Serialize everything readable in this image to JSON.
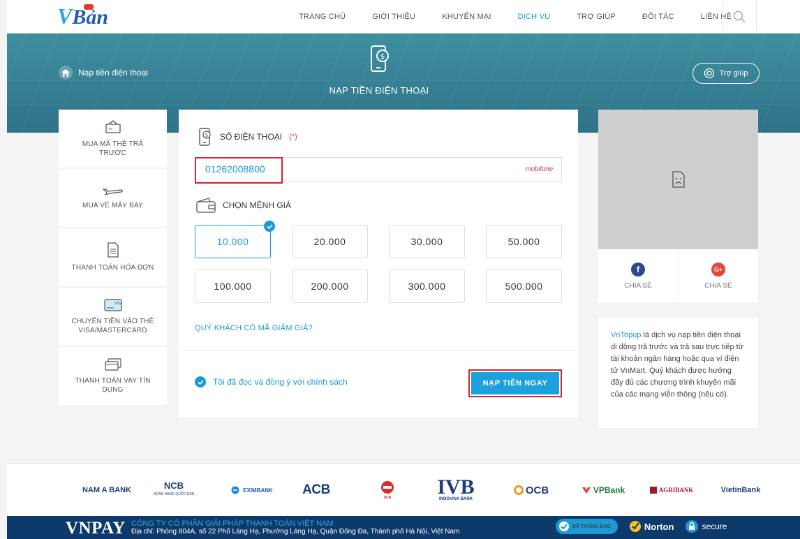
{
  "header": {
    "logo_text": "Bản",
    "logo_v": "V",
    "nav": [
      "TRANG CHỦ",
      "GIỚI THIỆU",
      "KHUYẾN MẠI",
      "DỊCH VỤ",
      "TRỢ GIÚP",
      "ĐỐI TÁC",
      "LIÊN HỆ"
    ],
    "active_nav": "DỊCH VỤ"
  },
  "banner": {
    "breadcrumb": "Nạp tiền điện thoại",
    "title": "NẠP TIỀN ĐIỆN THOẠI",
    "help_label": "Trợ giúp"
  },
  "sidebar": {
    "items": [
      {
        "label": "MUA MÃ THẺ TRẢ TRƯỚC",
        "icon": "prepaid-card-icon"
      },
      {
        "label": "MUA VÉ MÁY BAY",
        "icon": "airplane-icon"
      },
      {
        "label": "THANH TOÁN HÓA ĐƠN",
        "icon": "bill-icon"
      },
      {
        "label": "CHUYỂN TIỀN VÀO THẺ VISA/MASTERCARD",
        "icon": "visa-card-icon"
      },
      {
        "label": "THANH TOÁN VAY TÍN DỤNG",
        "icon": "credit-card-icon"
      }
    ]
  },
  "form": {
    "phone_label": "SỐ ĐIỆN THOẠI",
    "required_mark": "(*)",
    "phone_value": "01262008800",
    "carrier_prefix": "mobi",
    "carrier_f": "f",
    "carrier_suffix": "one",
    "denom_label": "CHỌN MỆNH GIÁ",
    "denominations": [
      "10.000",
      "20.000",
      "30.000",
      "50.000",
      "100.000",
      "200.000",
      "300.000",
      "500.000"
    ],
    "selected_denomination": "10.000",
    "promo_link": "QUÝ KHÁCH CÓ MÃ GIẢM GIÁ?",
    "agree_text": "Tôi đã đọc và đồng ý với chính sách",
    "submit_label": "NẠP TIỀN NGAY"
  },
  "right": {
    "share_facebook": "CHIA SẺ",
    "share_google": "CHIA SẺ",
    "desc_brand": "VnTopup",
    "desc_text": " là dịch vụ nạp tiền điện thoại di động trả trước và trả sau trực tiếp từ tài khoản ngân hàng hoặc qua ví điện tử VnMart. Quý khách được hưởng đầy đủ các chương trình khuyến mãi của các mạng viễn thông (nếu có)."
  },
  "banks": {
    "nama": "NAM A BANK",
    "ncb": "NCB",
    "ncb_sub": "NGÂN HÀNG QUỐC DÂN",
    "exim": "EXIMBANK",
    "acb": "ACB",
    "scb": "SCB",
    "ivb": "IVB",
    "ivb_sub": "INDOVINA BANK",
    "ocb": "OCB",
    "vp": "VPBank",
    "agri": "AGRIBANK",
    "vtb": "VietinBank"
  },
  "footer": {
    "brand": "VNPAY",
    "company_name": "CÔNG TY CỔ PHẦN GIẢI PHÁP THANH TOÁN VIỆT NAM",
    "address": "Địa chỉ: Phòng 804A, số 22 Phố Láng Hạ, Phường Láng Hạ, Quận Đống Đa, Thành phố Hà Nội, Việt Nam",
    "badge_registered": "ĐÃ THÔNG BÁO",
    "badge_norton": "Norton",
    "badge_secure": "secure"
  },
  "colors": {
    "accent": "#1a9ad6",
    "highlight_red": "#d9232d",
    "banner": "#367f93",
    "footer": "#0d3a6b"
  }
}
